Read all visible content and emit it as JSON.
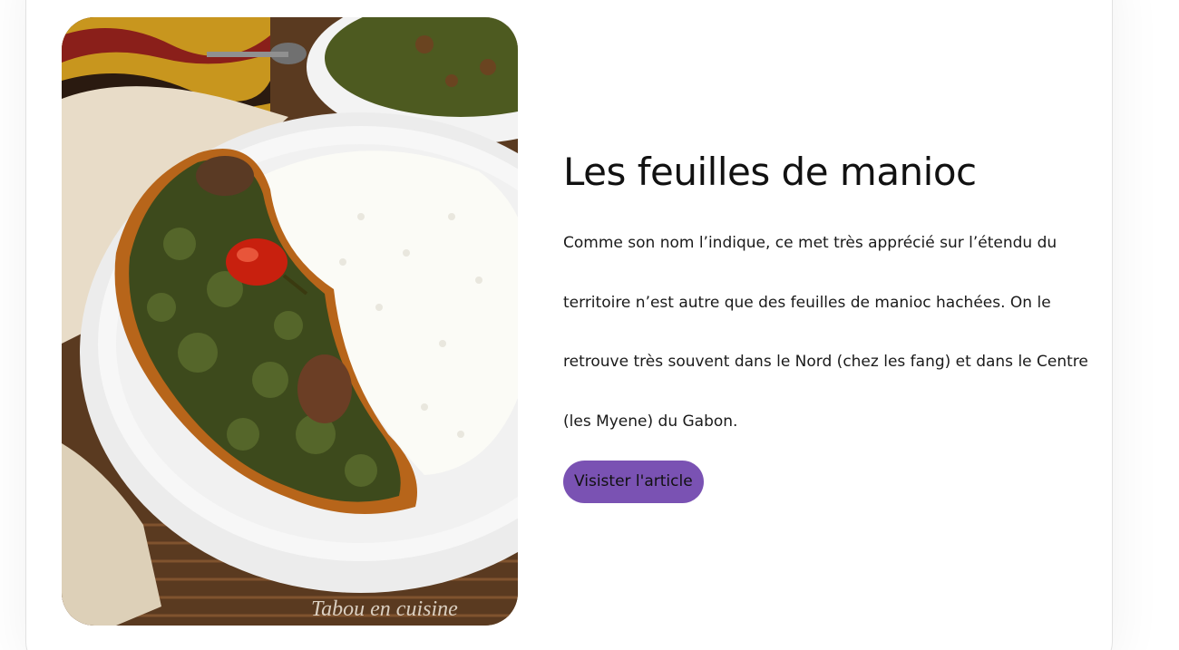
{
  "article": {
    "title": "Les feuilles de manioc",
    "description": "Comme son nom l’indique, ce met très apprécié sur l’étendu du territoire n’est autre que des feuilles de manioc hachées. On le retrouve très souvent dans le Nord (chez les fang) et dans le Centre (les Myene) du Gabon.",
    "button_label": "Visister l'article",
    "photo_watermark": "Tabou en cuisine"
  },
  "colors": {
    "button_bg": "#7a52b3",
    "card_border": "#e2e2e2"
  }
}
